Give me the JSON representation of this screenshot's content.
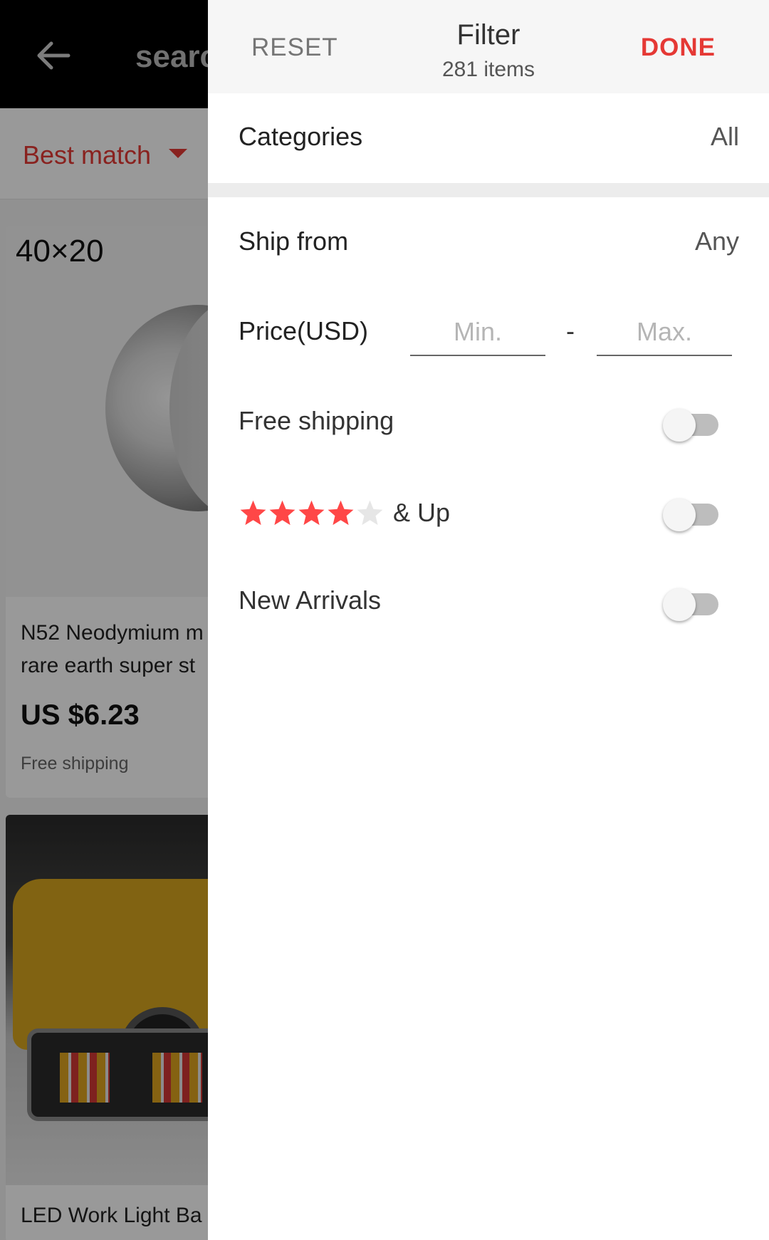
{
  "background": {
    "search_text": "searc",
    "sort_label": "Best match",
    "product1": {
      "size_label": "40×20",
      "title_line1": "N52 Neodymium m",
      "title_line2": "rare earth super st",
      "price": "US $6.23",
      "shipping": "Free shipping"
    },
    "product2": {
      "title": "LED Work Light Ba"
    }
  },
  "filter": {
    "reset_label": "RESET",
    "title": "Filter",
    "count": "281 items",
    "done_label": "DONE",
    "categories": {
      "label": "Categories",
      "value": "All"
    },
    "ship_from": {
      "label": "Ship from",
      "value": "Any"
    },
    "price": {
      "label": "Price(USD)",
      "min_placeholder": "Min.",
      "max_placeholder": "Max.",
      "separator": "-"
    },
    "free_shipping": {
      "label": "Free shipping",
      "enabled": false
    },
    "rating": {
      "stars_filled": 4,
      "stars_total": 5,
      "suffix": "& Up",
      "enabled": false
    },
    "new_arrivals": {
      "label": "New Arrivals",
      "enabled": false
    }
  },
  "colors": {
    "accent": "#e53935",
    "star_filled": "#ff4747",
    "star_empty": "#e6e6e6"
  }
}
